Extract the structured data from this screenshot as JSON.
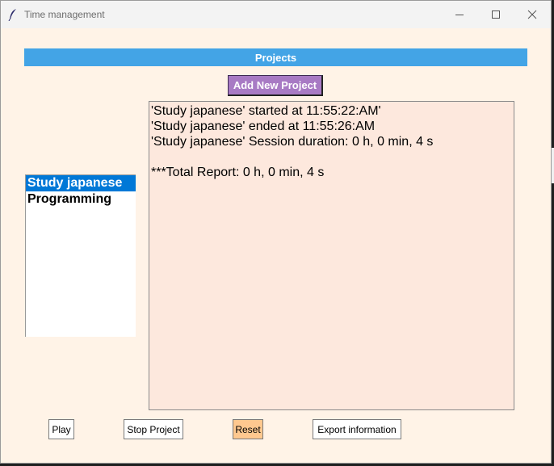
{
  "window": {
    "title": "Time management"
  },
  "header": {
    "projects_label": "Projects"
  },
  "toolbar": {
    "add_project_label": "Add New Project"
  },
  "projects": {
    "items": [
      {
        "label": "Study japanese",
        "selected": true
      },
      {
        "label": "Programming",
        "selected": false
      }
    ]
  },
  "log": {
    "lines": [
      "'Study japanese' started at 11:55:22:AM'",
      "'Study japanese' ended at 11:55:26:AM",
      "'Study japanese' Session duration: 0 h, 0 min, 4 s",
      "",
      "***Total Report: 0 h, 0 min, 4 s"
    ]
  },
  "buttons": {
    "play": "Play",
    "stop": "Stop Project",
    "reset": "Reset",
    "export": "Export information"
  },
  "colors": {
    "header_bg": "#43a4e6",
    "add_button_bg": "#a87ac4",
    "reset_bg": "#ffc88f",
    "selection": "#0078d7",
    "window_bg": "#fff3e7",
    "log_bg": "#fde8dd"
  }
}
